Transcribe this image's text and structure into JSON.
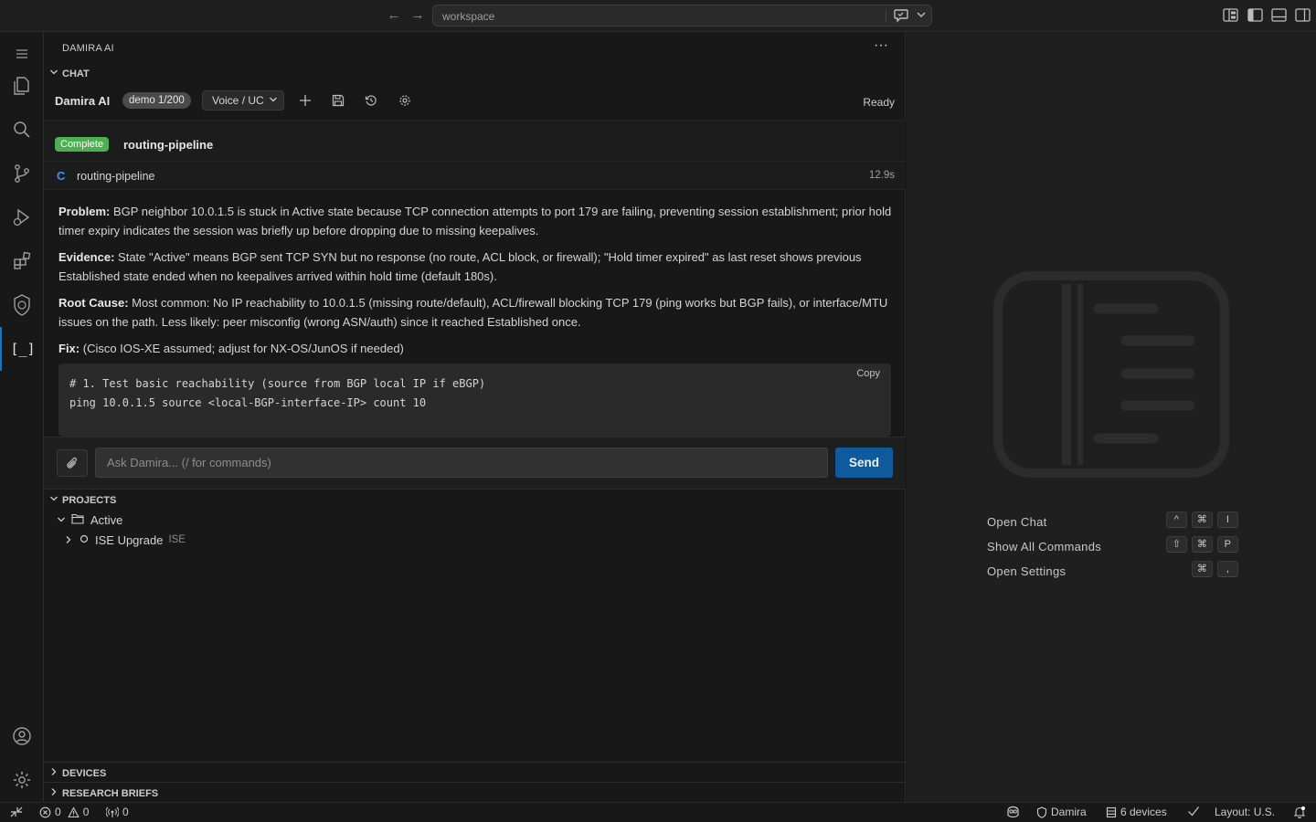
{
  "titlebar": {
    "search_text": "workspace",
    "back_icon": "arrow-left-icon",
    "forward_icon": "arrow-right-icon"
  },
  "panel": {
    "title": "DAMIRA AI",
    "chat_section": "CHAT",
    "brand": "Damira AI",
    "demo_badge": "demo 1/200",
    "mode_select": "Voice / UC",
    "status": "Ready"
  },
  "run": {
    "status_badge": "Complete",
    "name": "routing-pipeline",
    "tool_letter": "C",
    "tool_name": "routing-pipeline",
    "duration": "12.9s"
  },
  "answer": {
    "problem_label": "Problem:",
    "problem_text": " BGP neighbor 10.0.1.5 is stuck in Active state because TCP connection attempts to port 179 are failing, preventing session establishment; prior hold timer expiry indicates the session was briefly up before dropping due to missing keepalives.",
    "evidence_label": "Evidence:",
    "evidence_text": " State \"Active\" means BGP sent TCP SYN but no response (no route, ACL block, or firewall); \"Hold timer expired\" as last reset shows previous Established state ended when no keepalives arrived within hold time (default 180s).",
    "rootcause_label": "Root Cause:",
    "rootcause_text": " Most common: No IP reachability to 10.0.1.5 (missing route/default), ACL/firewall blocking TCP 179 (ping works but BGP fails), or interface/MTU issues on the path. Less likely: peer misconfig (wrong ASN/auth) since it reached Established once.",
    "fix_label": "Fix:",
    "fix_text": " (Cisco IOS-XE assumed; adjust for NX-OS/JunOS if needed)",
    "code_line1": "# 1. Test basic reachability (source from BGP local IP if eBGP)",
    "code_line2": "ping 10.0.1.5 source <local-BGP-interface-IP> count 10",
    "copy_label": "Copy"
  },
  "input": {
    "placeholder": "Ask Damira... (/ for commands)",
    "send_label": "Send"
  },
  "projects": {
    "section": "PROJECTS",
    "folder": "Active",
    "item": "ISE Upgrade",
    "item_tag": "ISE"
  },
  "bottom_sections": {
    "devices": "DEVICES",
    "research": "RESEARCH BRIEFS"
  },
  "welcome": {
    "shortcuts": [
      {
        "label": "Open Chat",
        "keys": [
          "^",
          "⌘",
          "I"
        ]
      },
      {
        "label": "Show All Commands",
        "keys": [
          "⇧",
          "⌘",
          "P"
        ]
      },
      {
        "label": "Open Settings",
        "keys": [
          "⌘",
          ","
        ]
      }
    ]
  },
  "statusbar": {
    "errors": "0",
    "warnings": "0",
    "ports": "0",
    "account": "Damira",
    "devices": "6 devices",
    "layout": "Layout: U.S."
  },
  "colors": {
    "accent": "#0078d4",
    "complete": "#4caf50",
    "send": "#0e5a9c"
  }
}
